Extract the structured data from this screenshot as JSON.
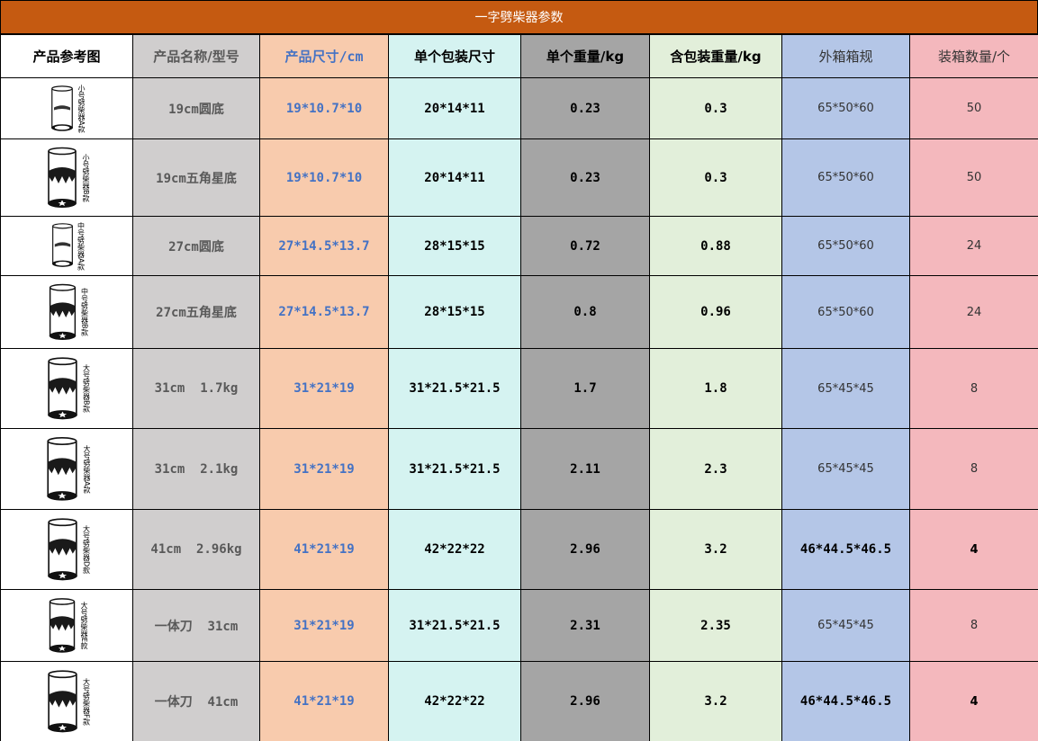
{
  "title": "一字劈柴器参数",
  "headers": {
    "image": "产品参考图",
    "name": "产品名称/型号",
    "size": "产品尺寸/cm",
    "pack": "单个包装尺寸",
    "weight": "单个重量/kg",
    "gross": "含包装重量/kg",
    "carton": "外箱箱规",
    "qty": "装箱数量/个"
  },
  "rows": [
    {
      "thumb_label": "小号劈柴器A款",
      "thumb_icon": "log-splitter-round-base-icon",
      "name": "19cm圆底",
      "size": "19*10.7*10",
      "pack": "20*14*11",
      "weight": "0.23",
      "gross": "0.3",
      "carton": "65*50*60",
      "qty": "50"
    },
    {
      "thumb_label": "小号劈柴器B款",
      "thumb_icon": "log-splitter-star-base-icon",
      "name": "19cm五角星底",
      "size": "19*10.7*10",
      "pack": "20*14*11",
      "weight": "0.23",
      "gross": "0.3",
      "carton": "65*50*60",
      "qty": "50"
    },
    {
      "thumb_label": "中号劈柴器A款",
      "thumb_icon": "log-splitter-round-base-icon",
      "name": "27cm圆底",
      "size": "27*14.5*13.7",
      "pack": "28*15*15",
      "weight": "0.72",
      "gross": "0.88",
      "carton": "65*50*60",
      "qty": "24"
    },
    {
      "thumb_label": "中号劈柴器B款",
      "thumb_icon": "log-splitter-star-base-icon",
      "name": "27cm五角星底",
      "size": "27*14.5*13.7",
      "pack": "28*15*15",
      "weight": "0.8",
      "gross": "0.96",
      "carton": "65*50*60",
      "qty": "24"
    },
    {
      "thumb_label": "大号劈柴器B款",
      "thumb_icon": "log-splitter-star-base-icon",
      "name": "31cm  1.7kg",
      "size": "31*21*19",
      "pack": "31*21.5*21.5",
      "weight": "1.7",
      "gross": "1.8",
      "carton": "65*45*45",
      "qty": "8"
    },
    {
      "thumb_label": "大号劈柴器A款",
      "thumb_icon": "log-splitter-star-base-icon",
      "name": "31cm  2.1kg",
      "size": "31*21*19",
      "pack": "31*21.5*21.5",
      "weight": "2.11",
      "gross": "2.3",
      "carton": "65*45*45",
      "qty": "8"
    },
    {
      "thumb_label": "大号劈柴器D款",
      "thumb_icon": "log-splitter-star-base-icon",
      "name": "41cm  2.96kg",
      "size": "41*21*19",
      "pack": "42*22*22",
      "weight": "2.96",
      "gross": "3.2",
      "carton": "46*44.5*46.5",
      "qty": "4",
      "bold_tail": true
    },
    {
      "thumb_label": "大号劈柴器E款",
      "thumb_icon": "log-splitter-star-base-icon",
      "name": "一体刀  31cm",
      "size": "31*21*19",
      "pack": "31*21.5*21.5",
      "weight": "2.31",
      "gross": "2.35",
      "carton": "65*45*45",
      "qty": "8"
    },
    {
      "thumb_label": "大号劈柴器F款",
      "thumb_icon": "log-splitter-star-base-icon",
      "name": "一体刀  41cm",
      "size": "41*21*19",
      "pack": "42*22*22",
      "weight": "2.96",
      "gross": "3.2",
      "carton": "46*44.5*46.5",
      "qty": "4",
      "bold_tail": true
    }
  ]
}
